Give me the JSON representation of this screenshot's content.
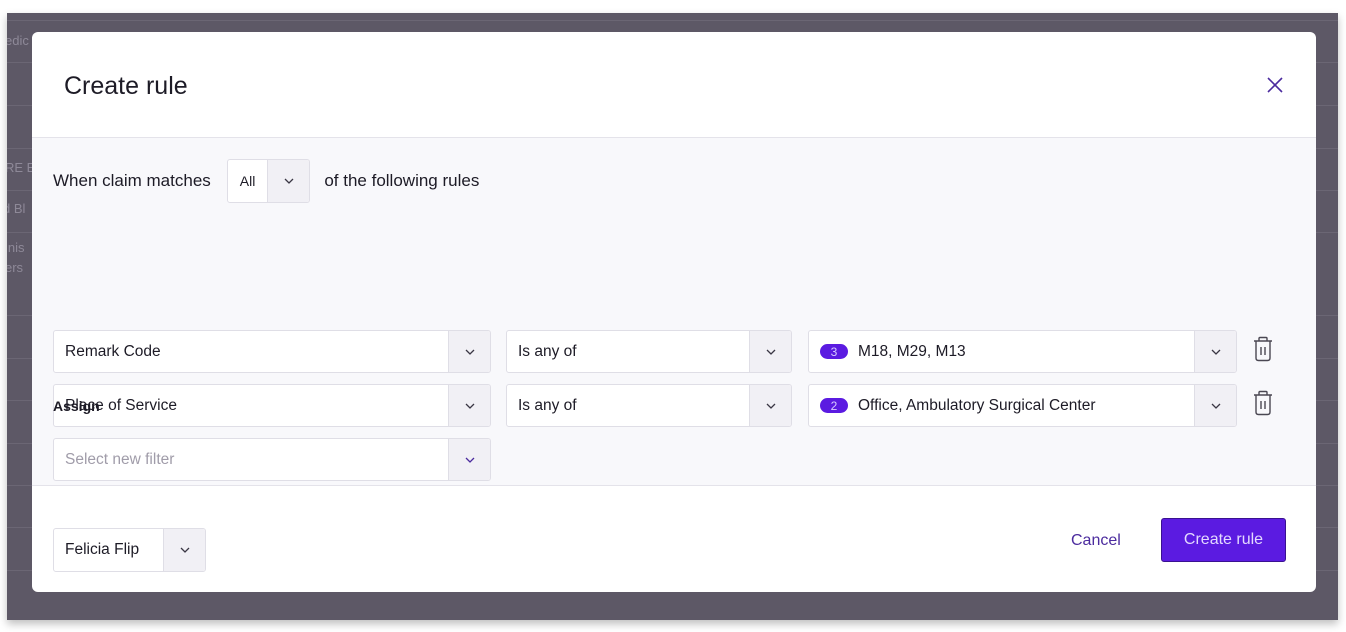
{
  "background": {
    "row_fragments": [
      "edic",
      "RE E",
      "d Bl",
      "inis",
      "ers"
    ]
  },
  "modal": {
    "title": "Create rule",
    "close_icon": "close-icon",
    "match": {
      "prefix": "When claim matches",
      "value": "All",
      "suffix": "of the following rules"
    },
    "rules": [
      {
        "field": "Remark Code",
        "operator": "Is any of",
        "count": "3",
        "values": "M18, M29, M13"
      },
      {
        "field": "Place of Service",
        "operator": "Is any of",
        "count": "2",
        "values": "Office, Ambulatory Surgical Center"
      }
    ],
    "new_filter_placeholder": "Select new filter",
    "assign": {
      "label": "Assign",
      "value": "Felicia Flip"
    },
    "footer": {
      "cancel_label": "Cancel",
      "submit_label": "Create rule"
    }
  },
  "colors": {
    "accent": "#5b1be1",
    "accent_text": "#4b2b9e",
    "backdrop": "#5d5866"
  }
}
